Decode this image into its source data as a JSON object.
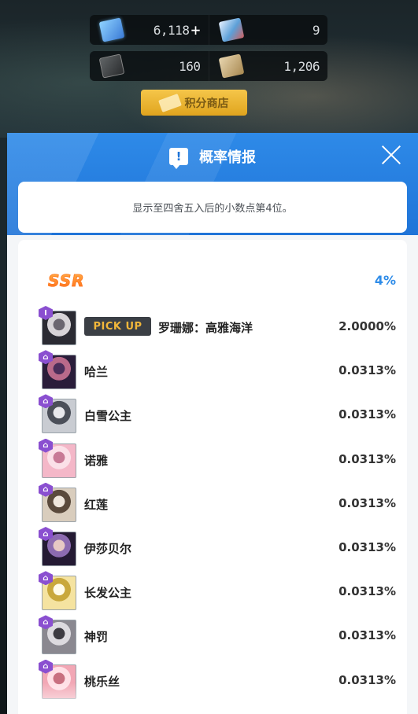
{
  "currency": {
    "row1": [
      {
        "icon": "crystal-icon",
        "value": "6,118",
        "plus": "+"
      },
      {
        "icon": "ticket-icon",
        "value": "9"
      }
    ],
    "row2": [
      {
        "icon": "box-icon",
        "value": "160"
      },
      {
        "icon": "voucher-icon",
        "value": "1,206"
      }
    ]
  },
  "shop_button": {
    "label": "积分商店"
  },
  "panel": {
    "title": "概率情报",
    "info_icon_glyph": "!",
    "notice": "显示至四舍五入后的小数点第4位。",
    "grade": {
      "label": "SSR",
      "rate": "4%"
    },
    "pickup_label": "PICK UP",
    "characters": [
      {
        "name": "罗珊娜：高雅海洋",
        "rate": "2.0000%",
        "badge": "I",
        "pickup": true,
        "colors": [
          "#2b2b33",
          "#d7d4d8",
          "#6a6670"
        ]
      },
      {
        "name": "哈兰",
        "rate": "0.0313%",
        "badge": "⌂",
        "pickup": false,
        "colors": [
          "#2a1d3a",
          "#b96a8a",
          "#4a2e5a"
        ]
      },
      {
        "name": "白雪公主",
        "rate": "0.0313%",
        "badge": "⌂",
        "pickup": false,
        "colors": [
          "#c9ccd2",
          "#4b4f59",
          "#e8e8ec"
        ]
      },
      {
        "name": "诺雅",
        "rate": "0.0313%",
        "badge": "⌂",
        "pickup": false,
        "colors": [
          "#f4b7c8",
          "#fbe0e8",
          "#c87a96"
        ]
      },
      {
        "name": "红莲",
        "rate": "0.0313%",
        "badge": "⌂",
        "pickup": false,
        "colors": [
          "#d9cdbd",
          "#5a4a3c",
          "#eee6dc"
        ]
      },
      {
        "name": "伊莎贝尔",
        "rate": "0.0313%",
        "badge": "⌂",
        "pickup": false,
        "colors": [
          "#241a33",
          "#8c6bb0",
          "#e7c9c4"
        ]
      },
      {
        "name": "长发公主",
        "rate": "0.0313%",
        "badge": "⌂",
        "pickup": false,
        "colors": [
          "#f5e3a0",
          "#c9a83c",
          "#fffbe8"
        ]
      },
      {
        "name": "神罚",
        "rate": "0.0313%",
        "badge": "⌂",
        "pickup": false,
        "colors": [
          "#8a8890",
          "#dcdadf",
          "#3d3b42"
        ]
      },
      {
        "name": "桃乐丝",
        "rate": "0.0313%",
        "badge": "⌂",
        "pickup": false,
        "colors": [
          "#f2a7b5",
          "#ffe0e6",
          "#c87080"
        ]
      }
    ]
  }
}
